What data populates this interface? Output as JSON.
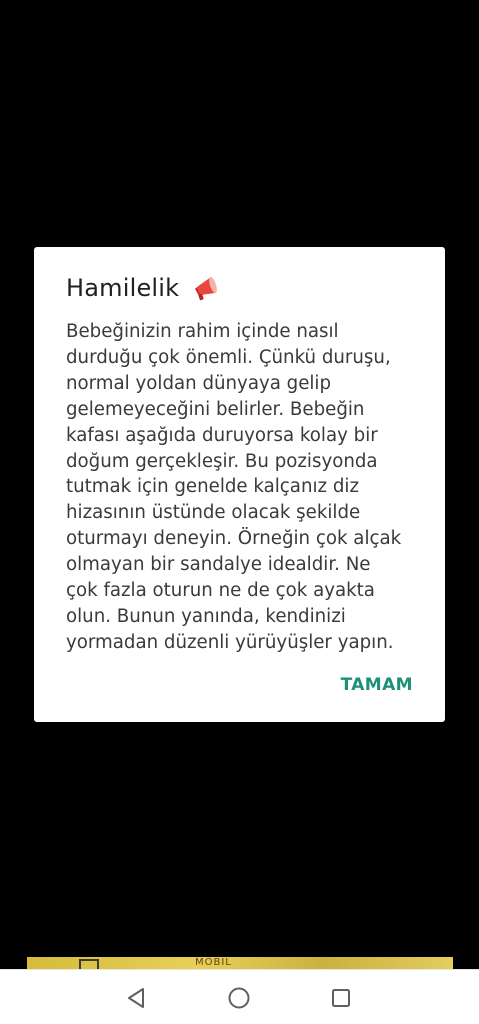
{
  "dialog": {
    "title": "Hamilelik",
    "title_icon": "megaphone-icon",
    "message": "Bebeğinizin rahim içinde nasıl\ndurduğu çok önemli. Çünkü duruşu,\nnormal yoldan dünyaya gelip\ngelemeyeceğini belirler. Bebeğin\nkafası aşağıda duruyorsa kolay bir\ndoğum gerçekleşir. Bu pozisyonda\ntutmak için genelde kalçanız diz\nhizasının üstünde olacak şekilde\noturmayı deneyin. Örneğin çok alçak\nolmayan bir sandalye idealdir. Ne\nçok fazla oturun ne de çok ayakta\nolun. Bunun yanında, kendinizi\nyormadan düzenli yürüyüşler yapın.",
    "confirm_label": "TAMAM",
    "accent_color": "#1e8f7a"
  },
  "banner": {
    "text": "MOBİL"
  },
  "navbar": {
    "back_icon": "back-triangle-icon",
    "home_icon": "home-circle-icon",
    "recents_icon": "recents-square-icon"
  }
}
